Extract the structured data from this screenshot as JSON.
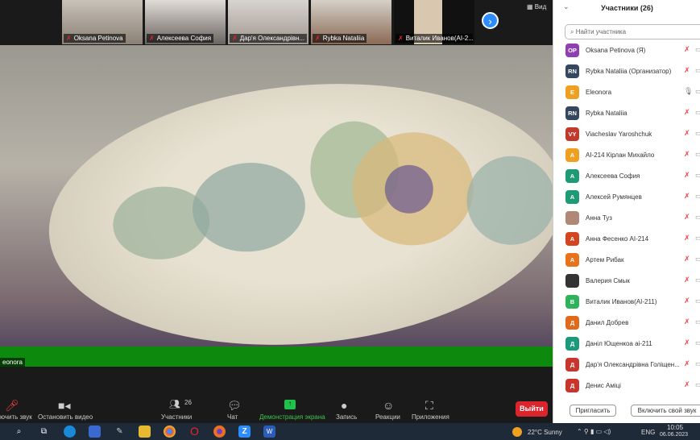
{
  "thumbnails": [
    {
      "name": "Oksana Petinova"
    },
    {
      "name": "Алексеева София"
    },
    {
      "name": "Дар'я Олександрівн..."
    },
    {
      "name": "Rybka Nataliia"
    },
    {
      "name": "Виталик Иванов(AI-2..."
    }
  ],
  "view_label": "Вид",
  "active_speaker": "eonora",
  "toolbar": {
    "mute": "ючить звук",
    "video": "Остановить видео",
    "participants": "Участники",
    "participants_count": "26",
    "chat": "Чат",
    "share": "Демонстрация экрана",
    "record": "Запись",
    "reactions": "Реакции",
    "apps": "Приложения",
    "leave": "Выйти"
  },
  "panel": {
    "title": "Участники (26)",
    "search_placeholder": "Найти участника",
    "participants": [
      {
        "initials": "OP",
        "name": "Oksana Petinova (Я)",
        "color": "#8e3fb0"
      },
      {
        "initials": "RN",
        "name": "Rybka Nataliia (Организатор)",
        "color": "#34475e"
      },
      {
        "initials": "E",
        "name": "Eleonora",
        "color": "#f0a020"
      },
      {
        "initials": "RN",
        "name": "Rybka Nataliia",
        "color": "#34475e"
      },
      {
        "initials": "VY",
        "name": "Viacheslav Yaroshchuk",
        "color": "#c0392b"
      },
      {
        "initials": "A",
        "name": "AI-214 Кірлан Михайло",
        "color": "#f0a020"
      },
      {
        "initials": "A",
        "name": "Алексеева София",
        "color": "#1e9a74"
      },
      {
        "initials": "A",
        "name": "Алексей Румянцев",
        "color": "#1e9a74"
      },
      {
        "initials": "",
        "name": "Анна Туз",
        "color": "#b08878"
      },
      {
        "initials": "А",
        "name": "Анна Фесенко AI-214",
        "color": "#d2451e"
      },
      {
        "initials": "А",
        "name": "Артем Рибак",
        "color": "#e8731a"
      },
      {
        "initials": "",
        "name": "Валерия Смык",
        "color": "#333333"
      },
      {
        "initials": "В",
        "name": "Виталик Иванов(AI-211)",
        "color": "#2fb35a"
      },
      {
        "initials": "Д",
        "name": "Данил Добрев",
        "color": "#e06a1a"
      },
      {
        "initials": "Д",
        "name": "Даніл Ющенкоа ai-211",
        "color": "#1a9a7a"
      },
      {
        "initials": "Д",
        "name": "Дар'я Олександрівна Голіщен...",
        "color": "#c9352b"
      },
      {
        "initials": "Д",
        "name": "Денис Аміці",
        "color": "#c9352b"
      }
    ],
    "invite": "Пригласить",
    "unmute_self": "Включить свой звук"
  },
  "taskbar": {
    "weather": "22°C  Sunny",
    "lang": "ENG",
    "time": "10:05",
    "date": "06.06.2023"
  }
}
